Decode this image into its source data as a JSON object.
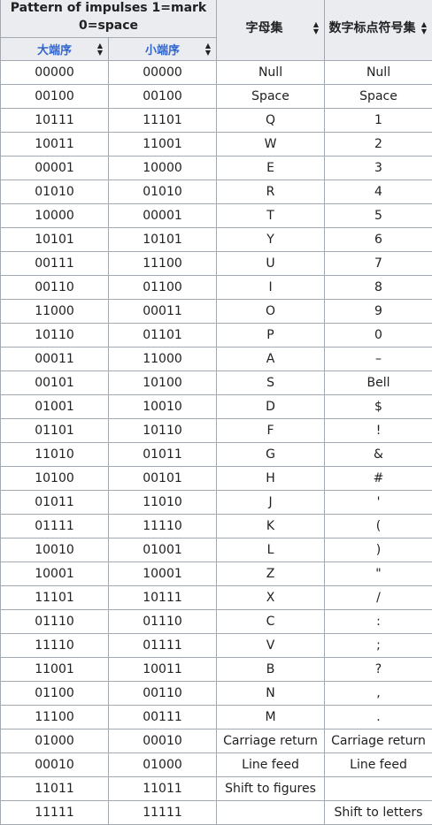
{
  "header": {
    "pattern_label": "Pattern of impulses 1=mark 0=space",
    "big_endian_label": "大端序",
    "little_endian_label": "小端序",
    "letters_label": "字母集",
    "figures_label": "数字标点符号集",
    "sort_icon": "sort-arrows-icon"
  },
  "rows": [
    {
      "big": "00000",
      "little": "00000",
      "letter": "Null",
      "figure": "Null"
    },
    {
      "big": "00100",
      "little": "00100",
      "letter": "Space",
      "figure": "Space"
    },
    {
      "big": "10111",
      "little": "11101",
      "letter": "Q",
      "figure": "1"
    },
    {
      "big": "10011",
      "little": "11001",
      "letter": "W",
      "figure": "2"
    },
    {
      "big": "00001",
      "little": "10000",
      "letter": "E",
      "figure": "3"
    },
    {
      "big": "01010",
      "little": "01010",
      "letter": "R",
      "figure": "4"
    },
    {
      "big": "10000",
      "little": "00001",
      "letter": "T",
      "figure": "5"
    },
    {
      "big": "10101",
      "little": "10101",
      "letter": "Y",
      "figure": "6"
    },
    {
      "big": "00111",
      "little": "11100",
      "letter": "U",
      "figure": "7"
    },
    {
      "big": "00110",
      "little": "01100",
      "letter": "I",
      "figure": "8"
    },
    {
      "big": "11000",
      "little": "00011",
      "letter": "O",
      "figure": "9"
    },
    {
      "big": "10110",
      "little": "01101",
      "letter": "P",
      "figure": "0"
    },
    {
      "big": "00011",
      "little": "11000",
      "letter": "A",
      "figure": "–"
    },
    {
      "big": "00101",
      "little": "10100",
      "letter": "S",
      "figure": "Bell"
    },
    {
      "big": "01001",
      "little": "10010",
      "letter": "D",
      "figure": "$"
    },
    {
      "big": "01101",
      "little": "10110",
      "letter": "F",
      "figure": "!"
    },
    {
      "big": "11010",
      "little": "01011",
      "letter": "G",
      "figure": "&"
    },
    {
      "big": "10100",
      "little": "00101",
      "letter": "H",
      "figure": "#"
    },
    {
      "big": "01011",
      "little": "11010",
      "letter": "J",
      "figure": "'"
    },
    {
      "big": "01111",
      "little": "11110",
      "letter": "K",
      "figure": "("
    },
    {
      "big": "10010",
      "little": "01001",
      "letter": "L",
      "figure": ")"
    },
    {
      "big": "10001",
      "little": "10001",
      "letter": "Z",
      "figure": "\""
    },
    {
      "big": "11101",
      "little": "10111",
      "letter": "X",
      "figure": "/"
    },
    {
      "big": "01110",
      "little": "01110",
      "letter": "C",
      "figure": ":"
    },
    {
      "big": "11110",
      "little": "01111",
      "letter": "V",
      "figure": ";"
    },
    {
      "big": "11001",
      "little": "10011",
      "letter": "B",
      "figure": "?"
    },
    {
      "big": "01100",
      "little": "00110",
      "letter": "N",
      "figure": ","
    },
    {
      "big": "11100",
      "little": "00111",
      "letter": "M",
      "figure": "."
    },
    {
      "big": "01000",
      "little": "00010",
      "letter": "Carriage return",
      "figure": "Carriage return"
    },
    {
      "big": "00010",
      "little": "01000",
      "letter": "Line feed",
      "figure": "Line feed"
    },
    {
      "big": "11011",
      "little": "11011",
      "letter": "Shift to figures",
      "figure": ""
    },
    {
      "big": "11111",
      "little": "11111",
      "letter": "",
      "figure": "Shift to letters"
    }
  ]
}
